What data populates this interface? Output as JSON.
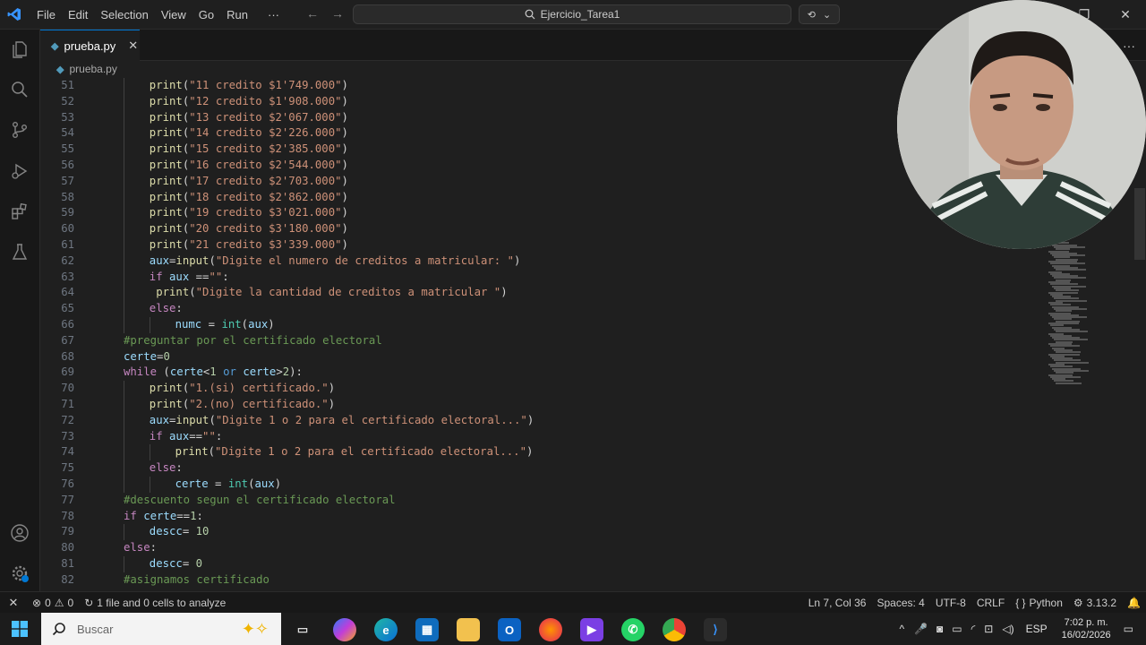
{
  "menu": [
    "File",
    "Edit",
    "Selection",
    "View",
    "Go",
    "Run",
    "···"
  ],
  "search_text": "Ejercicio_Tarea1",
  "tab": {
    "label": "prueba.py",
    "close": "✕"
  },
  "breadcrumb": "prueba.py",
  "code_lines": [
    {
      "n": "51",
      "indent": 2,
      "t": [
        [
          "fn",
          "print"
        ],
        [
          "op",
          "("
        ],
        [
          "str",
          "\"11 credito $1'749.000\""
        ],
        [
          "op",
          ")"
        ]
      ]
    },
    {
      "n": "52",
      "indent": 2,
      "t": [
        [
          "fn",
          "print"
        ],
        [
          "op",
          "("
        ],
        [
          "str",
          "\"12 credito $1'908.000\""
        ],
        [
          "op",
          ")"
        ]
      ]
    },
    {
      "n": "53",
      "indent": 2,
      "t": [
        [
          "fn",
          "print"
        ],
        [
          "op",
          "("
        ],
        [
          "str",
          "\"13 credito $2'067.000\""
        ],
        [
          "op",
          ")"
        ]
      ]
    },
    {
      "n": "54",
      "indent": 2,
      "t": [
        [
          "fn",
          "print"
        ],
        [
          "op",
          "("
        ],
        [
          "str",
          "\"14 credito $2'226.000\""
        ],
        [
          "op",
          ")"
        ]
      ]
    },
    {
      "n": "55",
      "indent": 2,
      "t": [
        [
          "fn",
          "print"
        ],
        [
          "op",
          "("
        ],
        [
          "str",
          "\"15 credito $2'385.000\""
        ],
        [
          "op",
          ")"
        ]
      ]
    },
    {
      "n": "56",
      "indent": 2,
      "t": [
        [
          "fn",
          "print"
        ],
        [
          "op",
          "("
        ],
        [
          "str",
          "\"16 credito $2'544.000\""
        ],
        [
          "op",
          ")"
        ]
      ]
    },
    {
      "n": "57",
      "indent": 2,
      "t": [
        [
          "fn",
          "print"
        ],
        [
          "op",
          "("
        ],
        [
          "str",
          "\"17 credito $2'703.000\""
        ],
        [
          "op",
          ")"
        ]
      ]
    },
    {
      "n": "58",
      "indent": 2,
      "t": [
        [
          "fn",
          "print"
        ],
        [
          "op",
          "("
        ],
        [
          "str",
          "\"18 credito $2'862.000\""
        ],
        [
          "op",
          ")"
        ]
      ]
    },
    {
      "n": "59",
      "indent": 2,
      "t": [
        [
          "fn",
          "print"
        ],
        [
          "op",
          "("
        ],
        [
          "str",
          "\"19 credito $3'021.000\""
        ],
        [
          "op",
          ")"
        ]
      ]
    },
    {
      "n": "60",
      "indent": 2,
      "t": [
        [
          "fn",
          "print"
        ],
        [
          "op",
          "("
        ],
        [
          "str",
          "\"20 credito $3'180.000\""
        ],
        [
          "op",
          ")"
        ]
      ]
    },
    {
      "n": "61",
      "indent": 2,
      "t": [
        [
          "fn",
          "print"
        ],
        [
          "op",
          "("
        ],
        [
          "str",
          "\"21 credito $3'339.000\""
        ],
        [
          "op",
          ")"
        ]
      ]
    },
    {
      "n": "62",
      "indent": 2,
      "t": [
        [
          "var",
          "aux"
        ],
        [
          "op",
          "="
        ],
        [
          "fn",
          "input"
        ],
        [
          "op",
          "("
        ],
        [
          "str",
          "\"Digite el numero de creditos a matricular: \""
        ],
        [
          "op",
          ")"
        ]
      ]
    },
    {
      "n": "63",
      "indent": 2,
      "t": [
        [
          "kw",
          "if"
        ],
        [
          "op",
          " "
        ],
        [
          "var",
          "aux"
        ],
        [
          "op",
          " =="
        ],
        [
          "str",
          "\"\""
        ],
        [
          "op",
          ":"
        ]
      ]
    },
    {
      "n": "64",
      "indent": 2,
      "t": [
        [
          "op",
          " "
        ],
        [
          "fn",
          "print"
        ],
        [
          "op",
          "("
        ],
        [
          "str",
          "\"Digite la cantidad de creditos a matricular \""
        ],
        [
          "op",
          ")"
        ]
      ]
    },
    {
      "n": "65",
      "indent": 2,
      "t": [
        [
          "kw",
          "else"
        ],
        [
          "op",
          ":"
        ]
      ]
    },
    {
      "n": "66",
      "indent": 3,
      "t": [
        [
          "var",
          "numc"
        ],
        [
          "op",
          " = "
        ],
        [
          "bi",
          "int"
        ],
        [
          "op",
          "("
        ],
        [
          "var",
          "aux"
        ],
        [
          "op",
          ")"
        ]
      ]
    },
    {
      "n": "67",
      "indent": 1,
      "t": [
        [
          "cm",
          "#preguntar por el certificado electoral"
        ]
      ]
    },
    {
      "n": "68",
      "indent": 1,
      "t": [
        [
          "var",
          "certe"
        ],
        [
          "op",
          "="
        ],
        [
          "num",
          "0"
        ]
      ]
    },
    {
      "n": "69",
      "indent": 1,
      "t": [
        [
          "kw",
          "while"
        ],
        [
          "op",
          " ("
        ],
        [
          "var",
          "certe"
        ],
        [
          "op",
          "<"
        ],
        [
          "num",
          "1"
        ],
        [
          "op",
          " "
        ],
        [
          "kw2",
          "or"
        ],
        [
          "op",
          " "
        ],
        [
          "var",
          "certe"
        ],
        [
          "op",
          ">"
        ],
        [
          "num",
          "2"
        ],
        [
          "op",
          "):"
        ]
      ]
    },
    {
      "n": "70",
      "indent": 2,
      "t": [
        [
          "fn",
          "print"
        ],
        [
          "op",
          "("
        ],
        [
          "str",
          "\"1.(si) certificado.\""
        ],
        [
          "op",
          ")"
        ]
      ]
    },
    {
      "n": "71",
      "indent": 2,
      "t": [
        [
          "fn",
          "print"
        ],
        [
          "op",
          "("
        ],
        [
          "str",
          "\"2.(no) certificado.\""
        ],
        [
          "op",
          ")"
        ]
      ]
    },
    {
      "n": "72",
      "indent": 2,
      "t": [
        [
          "var",
          "aux"
        ],
        [
          "op",
          "="
        ],
        [
          "fn",
          "input"
        ],
        [
          "op",
          "("
        ],
        [
          "str",
          "\"Digite 1 o 2 para el certificado electoral...\""
        ],
        [
          "op",
          ")"
        ]
      ]
    },
    {
      "n": "73",
      "indent": 2,
      "t": [
        [
          "kw",
          "if"
        ],
        [
          "op",
          " "
        ],
        [
          "var",
          "aux"
        ],
        [
          "op",
          "=="
        ],
        [
          "str",
          "\"\""
        ],
        [
          "op",
          ":"
        ]
      ]
    },
    {
      "n": "74",
      "indent": 3,
      "t": [
        [
          "fn",
          "print"
        ],
        [
          "op",
          "("
        ],
        [
          "str",
          "\"Digite 1 o 2 para el certificado electoral...\""
        ],
        [
          "op",
          ")"
        ]
      ]
    },
    {
      "n": "75",
      "indent": 2,
      "t": [
        [
          "kw",
          "else"
        ],
        [
          "op",
          ":"
        ]
      ]
    },
    {
      "n": "76",
      "indent": 3,
      "t": [
        [
          "var",
          "certe"
        ],
        [
          "op",
          " = "
        ],
        [
          "bi",
          "int"
        ],
        [
          "op",
          "("
        ],
        [
          "var",
          "aux"
        ],
        [
          "op",
          ")"
        ]
      ]
    },
    {
      "n": "77",
      "indent": 1,
      "t": [
        [
          "cm",
          "#descuento segun el certificado electoral"
        ]
      ]
    },
    {
      "n": "78",
      "indent": 1,
      "t": [
        [
          "kw",
          "if"
        ],
        [
          "op",
          " "
        ],
        [
          "var",
          "certe"
        ],
        [
          "op",
          "=="
        ],
        [
          "num",
          "1"
        ],
        [
          "op",
          ":"
        ]
      ]
    },
    {
      "n": "79",
      "indent": 2,
      "t": [
        [
          "var",
          "descc"
        ],
        [
          "op",
          "= "
        ],
        [
          "num",
          "10"
        ]
      ]
    },
    {
      "n": "80",
      "indent": 1,
      "t": [
        [
          "kw",
          "else"
        ],
        [
          "op",
          ":"
        ]
      ]
    },
    {
      "n": "81",
      "indent": 2,
      "t": [
        [
          "var",
          "descc"
        ],
        [
          "op",
          "= "
        ],
        [
          "num",
          "0"
        ]
      ]
    },
    {
      "n": "82",
      "indent": 1,
      "t": [
        [
          "cm",
          "#asignamos certificado"
        ]
      ]
    }
  ],
  "status": {
    "errors": "0",
    "warnings": "0",
    "analysis": "1 file and 0 cells to analyze",
    "position": "Ln 7, Col 36",
    "spaces": "Spaces: 4",
    "encoding": "UTF-8",
    "eol": "CRLF",
    "language": "Python",
    "version": "3.13.2"
  },
  "taskbar": {
    "search_placeholder": "Buscar",
    "lang": "ESP",
    "time": "7:02 p. m.",
    "date": "16/02/2026"
  }
}
